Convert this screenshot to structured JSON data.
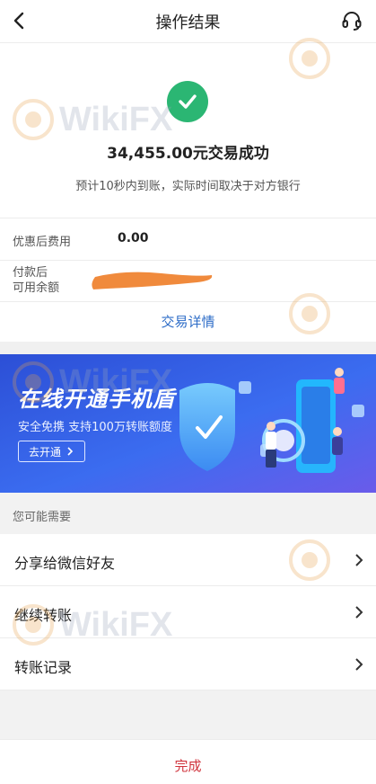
{
  "header": {
    "title": "操作结果",
    "back_icon": "back-arrow-icon",
    "support_icon": "headset-icon"
  },
  "result": {
    "amount_text": "34,455.00元交易成功",
    "hint": "预计10秒内到账，实际时间取决于对方银行",
    "success_color": "#2bb673"
  },
  "details": {
    "fee_label": "优惠后费用",
    "fee_value": "0.00",
    "balance_label_line1": "付款后",
    "balance_label_line2": "可用余额",
    "detail_link": "交易详情"
  },
  "banner": {
    "title": "在线开通手机盾",
    "subtitle": "安全免携 支持100万转账额度",
    "button": "去开通"
  },
  "suggest": {
    "label": "您可能需要",
    "items": [
      {
        "label": "分享给微信好友"
      },
      {
        "label": "继续转账"
      },
      {
        "label": "转账记录"
      }
    ]
  },
  "footer": {
    "done": "完成",
    "done_color": "#d0343d"
  },
  "watermark": {
    "text": "WikiFX"
  }
}
